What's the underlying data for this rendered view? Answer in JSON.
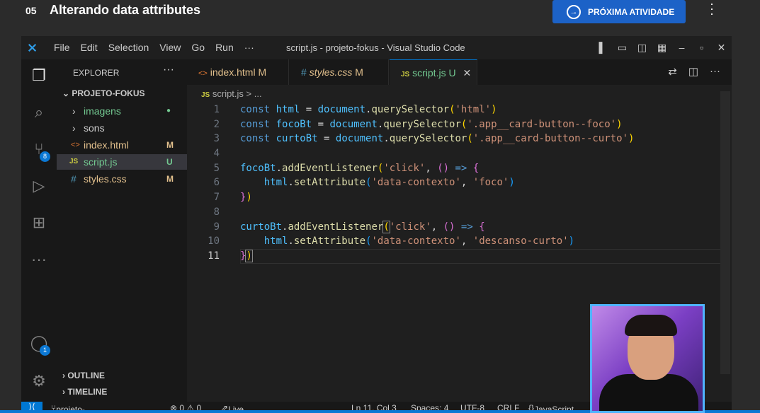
{
  "course": {
    "lesson_number": "05",
    "lesson_title": "Alterando data attributes",
    "next_button": "PRÓXIMA ATIVIDADE"
  },
  "vscode": {
    "menu": [
      "File",
      "Edit",
      "Selection",
      "View",
      "Go",
      "Run",
      "···"
    ],
    "window_title": "script.js - projeto-fokus - Visual Studio Code",
    "explorer_title": "EXPLORER",
    "project_name": "PROJETO-FOKUS",
    "files": [
      {
        "name": "imagens",
        "status": "●",
        "color": "#73c991"
      },
      {
        "name": "sons",
        "status": "",
        "color": "#cccccc"
      },
      {
        "name": "index.html",
        "status": "M",
        "color": "#e2c08d"
      },
      {
        "name": "script.js",
        "status": "U",
        "color": "#73c991"
      },
      {
        "name": "styles.css",
        "status": "M",
        "color": "#e2c08d"
      }
    ],
    "outline": "OUTLINE",
    "timeline": "TIMELINE",
    "source_control_badge": "8",
    "accounts_badge": "1",
    "tabs": [
      {
        "icon": "<>",
        "name": "index.html",
        "status": "M"
      },
      {
        "icon": "#",
        "name": "styles.css",
        "status": "M"
      },
      {
        "icon": "JS",
        "name": "script.js",
        "status": "U"
      }
    ],
    "breadcrumb": "script.js > ...",
    "line_numbers": [
      "1",
      "2",
      "3",
      "4",
      "5",
      "6",
      "7",
      "8",
      "9",
      "10",
      "11"
    ],
    "status": {
      "branch": "projeto-base*",
      "problems": "⊗ 0 ⚠ 0",
      "live_share": "Live Share",
      "position": "Ln 11, Col 3",
      "spaces": "Spaces: 4",
      "encoding": "UTF-8",
      "eol": "CRLF",
      "language": "JavaScript"
    }
  }
}
